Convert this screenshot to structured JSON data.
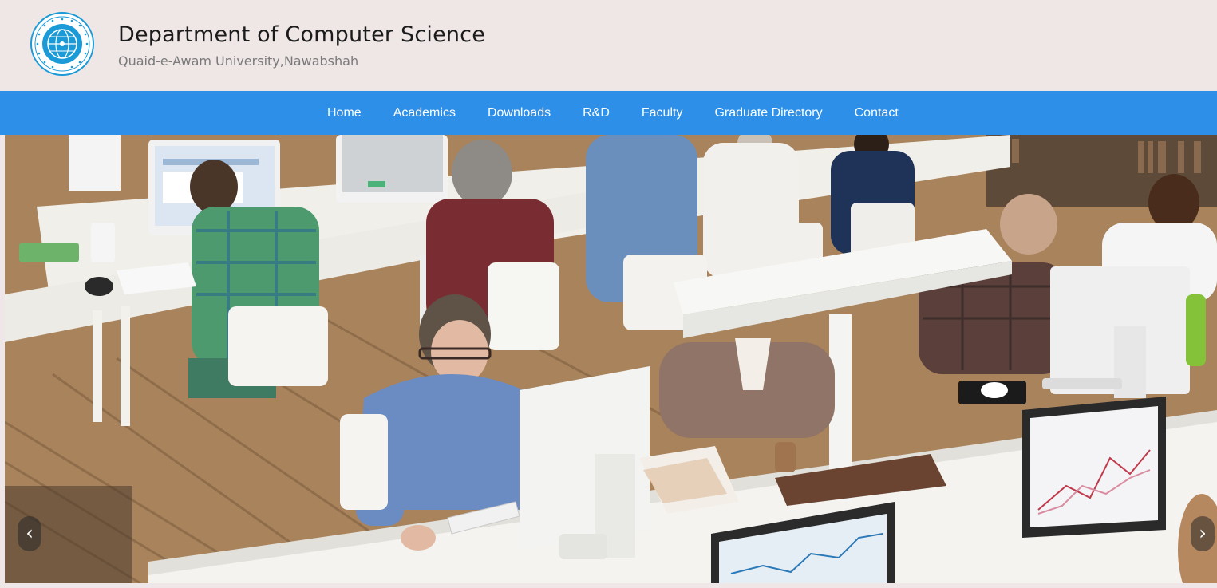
{
  "header": {
    "title": "Department of Computer Science",
    "subtitle": "Quaid-e-Awam University,Nawabshah",
    "logo_icon": "university-seal-icon"
  },
  "nav": {
    "items": [
      {
        "label": "Home"
      },
      {
        "label": "Academics"
      },
      {
        "label": "Downloads"
      },
      {
        "label": "R&D"
      },
      {
        "label": "Faculty"
      },
      {
        "label": "Graduate Directory"
      },
      {
        "label": "Contact"
      }
    ]
  },
  "carousel": {
    "prev_label": "‹",
    "next_label": "›",
    "image_alt": "computer-lab-photo"
  },
  "colors": {
    "header_bg": "#efe6e6",
    "nav_bg": "#2d8fe8",
    "nav_text": "#ffffff",
    "logo_blue": "#1a9ad6"
  }
}
